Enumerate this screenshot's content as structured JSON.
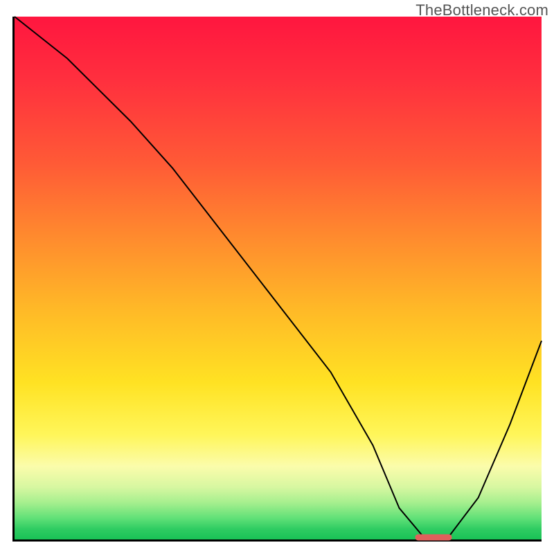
{
  "watermark": "TheBottleneck.com",
  "colors": {
    "axis": "#000000",
    "curve": "#000000",
    "marker": "#e0605c",
    "gradient_top": "#ff163f",
    "gradient_bottom": "#19c256"
  },
  "chart_data": {
    "type": "line",
    "title": "",
    "xlabel": "",
    "ylabel": "",
    "xlim": [
      0,
      100
    ],
    "ylim": [
      0,
      100
    ],
    "gradient_stops_pct_from_top": [
      {
        "pct": 0,
        "color": "#ff163f"
      },
      {
        "pct": 28,
        "color": "#ff5a36"
      },
      {
        "pct": 56,
        "color": "#ffb927"
      },
      {
        "pct": 80,
        "color": "#fff65a"
      },
      {
        "pct": 93,
        "color": "#a5ef8e"
      },
      {
        "pct": 100,
        "color": "#19c256"
      }
    ],
    "series": [
      {
        "name": "bottleneck-curve",
        "x": [
          0,
          10,
          22,
          30,
          40,
          50,
          60,
          68,
          73,
          78,
          82,
          88,
          94,
          100
        ],
        "y": [
          100,
          92,
          80,
          71,
          58,
          45,
          32,
          18,
          6,
          0,
          0,
          8,
          22,
          38
        ]
      }
    ],
    "marker": {
      "name": "optimal-range",
      "x_start": 76,
      "x_end": 83,
      "y": 0
    }
  }
}
